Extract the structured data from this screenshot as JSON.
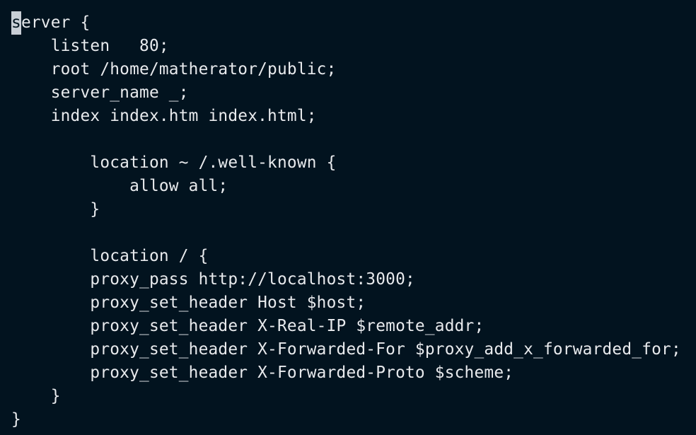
{
  "terminal": {
    "cursor_char": "s",
    "lines": [
      "erver {",
      "    listen   80;",
      "    root /home/matherator/public;",
      "    server_name _;",
      "    index index.htm index.html;",
      "",
      "        location ~ /.well-known {",
      "            allow all;",
      "        }",
      "",
      "        location / {",
      "        proxy_pass http://localhost:3000;",
      "        proxy_set_header Host $host;",
      "        proxy_set_header X-Real-IP $remote_addr;",
      "        proxy_set_header X-Forwarded-For $proxy_add_x_forwarded_for;",
      "        proxy_set_header X-Forwarded-Proto $scheme;",
      "    }",
      "}"
    ]
  }
}
